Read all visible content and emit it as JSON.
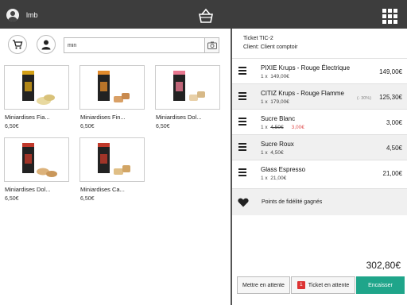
{
  "topbar": {
    "user_name": "lmb",
    "icons": {
      "avatar": "user-avatar-icon",
      "basket": "basket-icon",
      "apps": "grid-icon"
    },
    "background": "#3d3d3d"
  },
  "search": {
    "value": "min",
    "icons": {
      "cart": "cart-icon",
      "customer": "person-icon",
      "camera": "camera-icon"
    }
  },
  "products": [
    {
      "name": "Miniardises Fia...",
      "price": "6,50€",
      "accent": "#d4a017"
    },
    {
      "name": "Miniardises Fin...",
      "price": "6,50€",
      "accent": "#e08a2c"
    },
    {
      "name": "Miniardises Dol...",
      "price": "6,50€",
      "accent": "#e8778f"
    },
    {
      "name": "Miniardises Dol...",
      "price": "6,50€",
      "accent": "#c0392b"
    },
    {
      "name": "Miniardises Ca...",
      "price": "6,50€",
      "accent": "#c0392b"
    }
  ],
  "ticket": {
    "title": "Ticket TIC-2",
    "client": "Client: Client comptoir",
    "items": [
      {
        "name": "PIXIE Krups - Rouge Électrique",
        "qty": "1 x",
        "unit_price": "149,00€",
        "new_price": "",
        "discount": "",
        "total": "149,00€"
      },
      {
        "name": "CITIZ Krups - Rouge Flamme",
        "qty": "1 x",
        "unit_price": "179,00€",
        "new_price": "",
        "discount": "(- 30%)",
        "total": "125,30€"
      },
      {
        "name": "Sucre Blanc",
        "qty": "1 x",
        "unit_price": "4,50€",
        "new_price": "3,00€",
        "discount": "",
        "total": "3,00€"
      },
      {
        "name": "Sucre Roux",
        "qty": "1 x",
        "unit_price": "4,50€",
        "new_price": "",
        "discount": "",
        "total": "4,50€"
      },
      {
        "name": "Glass Espresso",
        "qty": "1 x",
        "unit_price": "21,00€",
        "new_price": "",
        "discount": "",
        "total": "21,00€"
      }
    ],
    "loyalty_label": "Points de fidélité gagnés",
    "grand_total": "302,80€"
  },
  "actions": {
    "hold_label": "Mettre en attente",
    "held_count": "1",
    "held_label": "Ticket en attente",
    "pay_label": "Encaisser"
  },
  "colors": {
    "accent": "#1fa58a",
    "badge": "#dd3333",
    "price_change": "#e05050"
  }
}
